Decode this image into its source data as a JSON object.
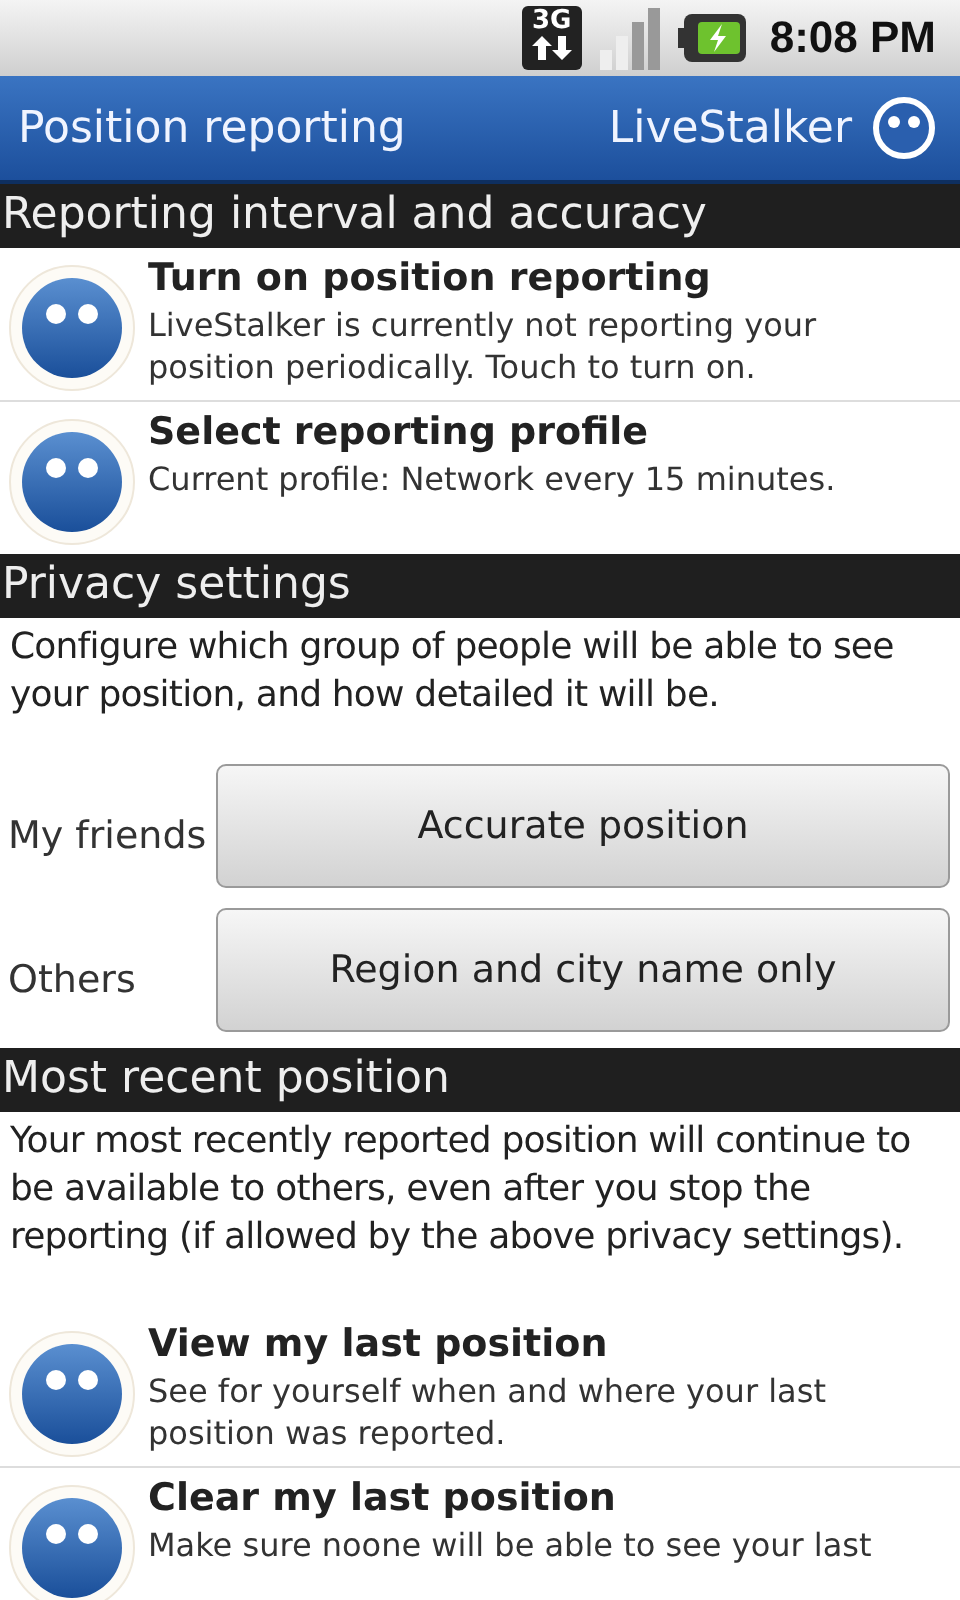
{
  "status_bar": {
    "network_label": "3G",
    "time": "8:08 PM"
  },
  "title_bar": {
    "title": "Position reporting",
    "app_name": "LiveStalker"
  },
  "sections": [
    {
      "header": "Reporting interval and accuracy",
      "items": [
        {
          "title": "Turn on position reporting",
          "summary": "LiveStalker is currently not reporting your position periodically. Touch to turn on."
        },
        {
          "title": "Select reporting profile",
          "summary": "Current profile: Network every 15 minutes."
        }
      ]
    },
    {
      "header": "Privacy settings",
      "description": "Configure which group of people will be able to see your position, and how detailed it will be.",
      "choices": [
        {
          "label": "My friends",
          "value": "Accurate position"
        },
        {
          "label": "Others",
          "value": "Region and city name only"
        }
      ]
    },
    {
      "header": "Most recent position",
      "description": "Your most recently reported position will continue to be available to others, even after you stop the reporting (if allowed by the above privacy settings).",
      "items": [
        {
          "title": "View my last position",
          "summary": "See for yourself when and where your last position was reported."
        },
        {
          "title": "Clear my last position",
          "summary": "Make sure noone will be able to see your last"
        }
      ]
    }
  ]
}
